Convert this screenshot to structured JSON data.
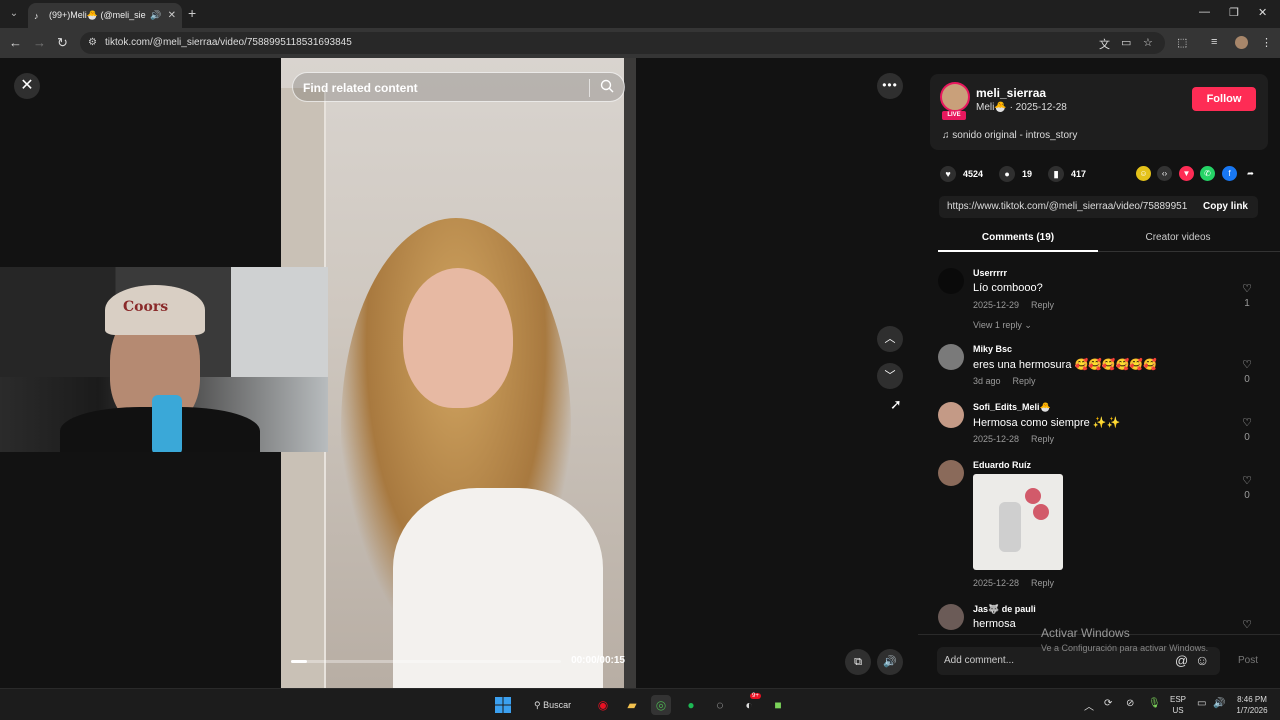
{
  "browser": {
    "tab_title": "(99+)Meli🐣 (@meli_sierra",
    "url": "tiktok.com/@meli_sierraa/video/7588995118531693845"
  },
  "video": {
    "search_placeholder": "Find related content",
    "timecode": "00:00/00:15",
    "progress": 0.06
  },
  "webcam_cap_text": "Coors",
  "author": {
    "username": "meli_sierraa",
    "display_and_date": "Meli🐣 · 2025-12-28",
    "live_badge": "LIVE",
    "follow_label": "Follow",
    "music": "sonido original - intros_story"
  },
  "stats": {
    "likes": "4524",
    "comments": "19",
    "saves": "417"
  },
  "share_link": {
    "url": "https://www.tiktok.com/@meli_sierraa/video/75889951...",
    "copy_label": "Copy link"
  },
  "tabs": {
    "comments": "Comments (19)",
    "creator": "Creator videos"
  },
  "comments": [
    {
      "name": "Userrrrr",
      "text": "Lío combooo?",
      "date": "2025-12-29",
      "reply": "Reply",
      "likes": "1",
      "view_replies": "View 1 reply ⌄"
    },
    {
      "name": "Miky Bsc",
      "text": "eres una hermosura 🥰🥰🥰🥰🥰🥰",
      "date": "3d ago",
      "reply": "Reply",
      "likes": "0"
    },
    {
      "name": "Sofi_Edits_Meli🐣",
      "text": "Hermosa como siempre ✨✨",
      "date": "2025-12-28",
      "reply": "Reply",
      "likes": "0"
    },
    {
      "name": "Eduardo Ruíz",
      "text": "",
      "date": "2025-12-28",
      "reply": "Reply",
      "likes": "0"
    },
    {
      "name": "Jas🐺 de pauli",
      "text": "hermosa",
      "date": "",
      "reply": "",
      "likes": ""
    }
  ],
  "composer": {
    "placeholder": "Add comment...",
    "post_label": "Post"
  },
  "watermark": {
    "line1": "Activar Windows",
    "line2": "Ve a Configuración para activar Windows."
  },
  "taskbar": {
    "search_label": "Buscar",
    "notif_badge": "9+",
    "lang_top": "ESP",
    "lang_bottom": "US",
    "time": "8:46 PM",
    "date": "1/7/2026"
  },
  "colors": {
    "accent": "#fe2c55",
    "live": "#e8185e"
  }
}
